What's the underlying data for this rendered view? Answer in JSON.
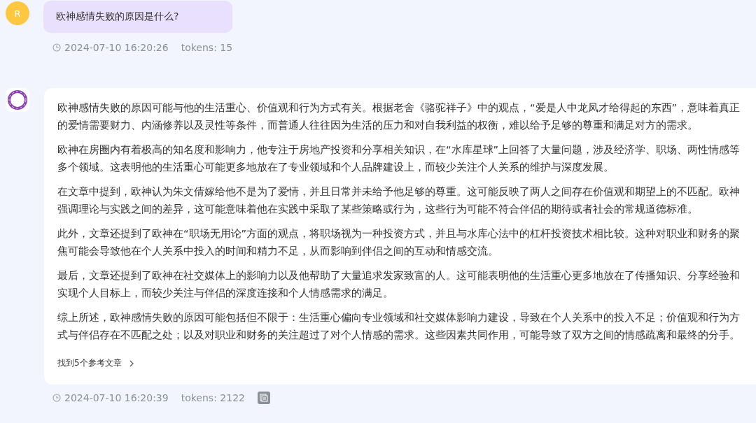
{
  "question": {
    "avatar": "R",
    "text": "欧神感情失败的原因是什么?",
    "time": "2024-07-10 16:20:26",
    "tokens": "tokens: 15"
  },
  "answer": {
    "paragraphs": [
      "欧神感情失败的原因可能与他的生活重心、价值观和行为方式有关。根据老舍《骆驼祥子》中的观点，“爱是人中龙凤才给得起的东西”，意味着真正的爱情需要财力、内涵修养以及灵性等条件，而普通人往往因为生活的压力和对自我利益的权衡，难以给予足够的尊重和满足对方的需求。",
      "欧神在房圈内有着极高的知名度和影响力，他专注于房地产投资和分享相关知识，在“水库星球”上回答了大量问题，涉及经济学、职场、两性情感等多个领域。这表明他的生活重心可能更多地放在了专业领域和个人品牌建设上，而较少关注个人关系的维护与深度发展。",
      "在文章中提到，欧神认为朱文倩嫁给他不是为了爱情，并且日常并未给予他足够的尊重。这可能反映了两人之间存在价值观和期望上的不匹配。欧神强调理论与实践之间的差异，这可能意味着他在实践中采取了某些策略或行为，这些行为可能不符合伴侣的期待或者社会的常规道德标准。",
      "此外，文章还提到了欧神在“职场无用论”方面的观点，将职场视为一种投资方式，并且与水库心法中的杠杆投资技术相比较。这种对职业和财务的聚焦可能会导致他在个人关系中投入的时间和精力不足，从而影响到伴侣之间的互动和情感交流。",
      "最后，文章还提到了欧神在社交媒体上的影响力以及他帮助了大量追求发家致富的人。这可能表明他的生活重心更多地放在了传播知识、分享经验和实现个人目标上，而较少关注与伴侣的深度连接和个人情感需求的满足。",
      "综上所述，欧神感情失败的原因可能包括但不限于：生活重心偏向专业领域和社交媒体影响力建设，导致在个人关系中的投入不足；价值观和行为方式与伴侣存在不匹配之处；以及对职业和财务的关注超过了对个人情感的需求。这些因素共同作用，可能导致了双方之间的情感疏离和最终的分手。"
    ],
    "references": "找到5个参考文章",
    "time": "2024-07-10 16:20:39",
    "tokens": "tokens: 2122"
  }
}
